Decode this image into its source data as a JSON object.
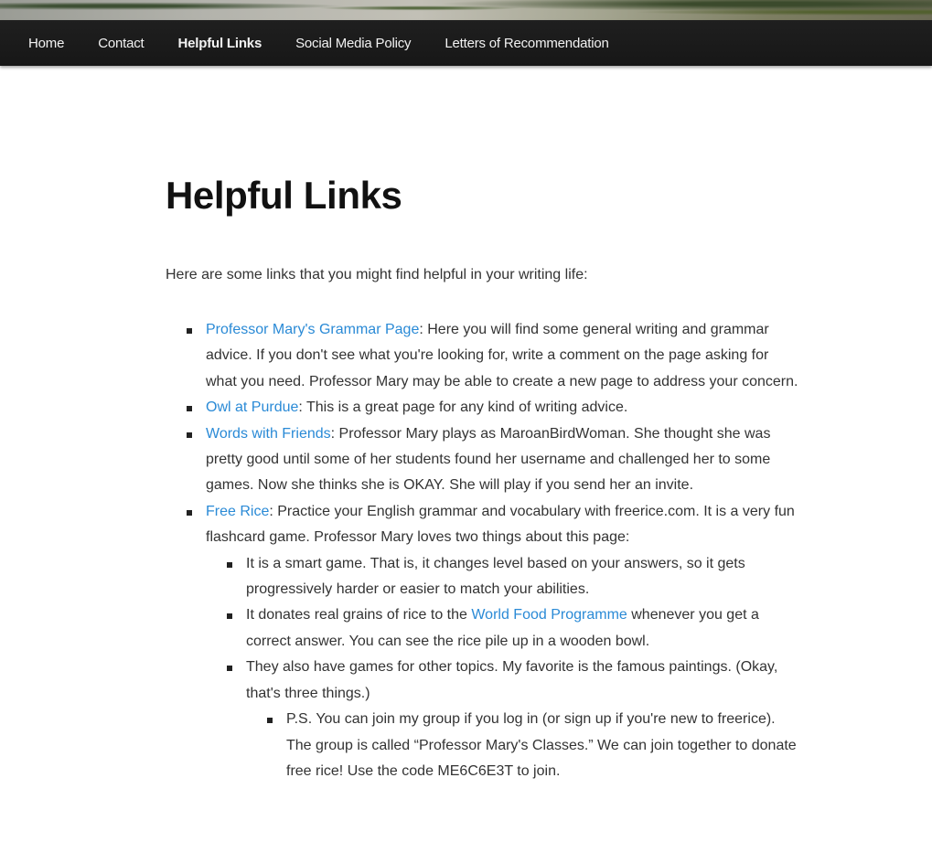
{
  "nav": {
    "items": [
      {
        "label": "Home"
      },
      {
        "label": "Contact"
      },
      {
        "label": "Helpful Links"
      },
      {
        "label": "Social Media Policy"
      },
      {
        "label": "Letters of Recommendation"
      }
    ],
    "active_index": 2
  },
  "page": {
    "title": "Helpful Links",
    "intro": "Here are some links that you might find helpful in your writing life:"
  },
  "links": [
    {
      "link": "Professor Mary's Grammar Page",
      "text": ": Here you will find some general writing and grammar advice. If you don't see what you're looking for, write a comment on the page asking for what you need. Professor Mary may be able to create a new page to address your concern."
    },
    {
      "link": "Owl at Purdue",
      "text": ": This is a great page for any kind of writing advice."
    },
    {
      "link": "Words with Friends",
      "text": ": Professor Mary plays as MaroanBirdWoman. She thought she was pretty good until some of her students found her username and challenged her to some games. Now she thinks she is OKAY. She will play if you send her an invite."
    },
    {
      "link": "Free Rice",
      "text": ": Practice your English grammar and vocabulary with freerice.com. It is a very fun flashcard game. Professor Mary loves two things about this page:"
    }
  ],
  "freerice": {
    "point1": "It is a smart game. That is, it changes level based on your answers, so it gets progressively harder or easier to match your abilities.",
    "point2_before": "It donates real grains of rice to the ",
    "point2_link": "World Food Programme",
    "point2_after": " whenever you get a correct answer. You can see the rice pile up in a wooden bowl.",
    "point3": "They also have games for other topics.  My favorite is the famous paintings. (Okay, that's three things.)",
    "ps": "P.S. You can join my group if you log in (or sign up if you're new to freerice). The group is called “Professor Mary's Classes.” We can join together to donate free rice! Use the code ME6C6E3T to join."
  },
  "colors": {
    "link": "#2a8ad6",
    "nav_bg": "#1c1c1c",
    "nav_text": "#f2f2f2"
  }
}
